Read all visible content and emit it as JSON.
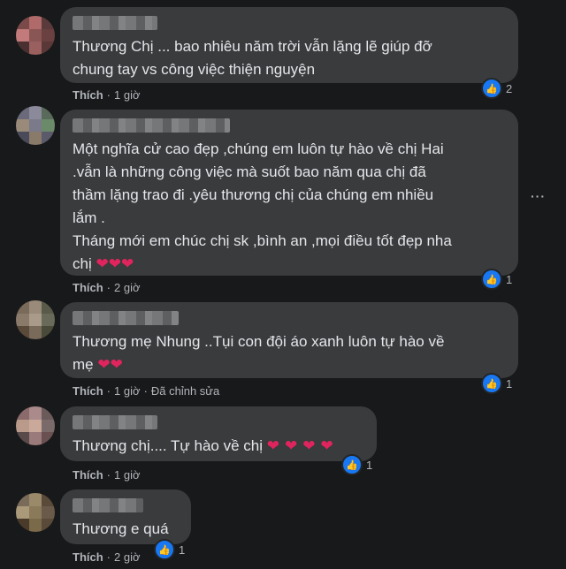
{
  "comments": [
    {
      "text": "Thương Chị ... bao nhiêu năm trời vẫn lặng lẽ giúp đỡ\nchung tay vs công việc thiện nguyện",
      "like_label": "Thích",
      "time": "1 giờ",
      "edited": "",
      "reaction_count": "2",
      "hearts": ""
    },
    {
      "text": "Một nghĩa cử cao đẹp ,chúng em luôn tự hào về chị Hai\n.vẫn là những công việc mà suốt bao năm qua chị đã\nthầm lặng trao đi .yêu thương chị của chúng em nhiều\nlắm .\nTháng mới em chúc chị sk ,bình an ,mọi điều tốt đẹp nha\nchị",
      "like_label": "Thích",
      "time": "2 giờ",
      "edited": "",
      "reaction_count": "1",
      "hearts": "❤❤❤"
    },
    {
      "text": "Thương mẹ Nhung ..Tụi con đội áo xanh luôn tự hào về\nmẹ",
      "like_label": "Thích",
      "time": "1 giờ",
      "edited": "Đã chỉnh sửa",
      "reaction_count": "1",
      "hearts": "❤❤"
    },
    {
      "text": "Thương chị.... Tự hào về chị",
      "like_label": "Thích",
      "time": "1 giờ",
      "edited": "",
      "reaction_count": "1",
      "hearts": "❤❤❤❤"
    },
    {
      "text": "Thương e quá",
      "like_label": "Thích",
      "time": "2 giờ",
      "edited": "",
      "reaction_count": "1",
      "hearts": ""
    }
  ],
  "icons": {
    "like": "like-icon",
    "heart": "heart-icon",
    "more": "more-options-icon"
  },
  "colors": {
    "background": "#18191a",
    "bubble": "#3a3b3c",
    "like_blue": "#1877f2",
    "heart_red": "#e0245e"
  }
}
